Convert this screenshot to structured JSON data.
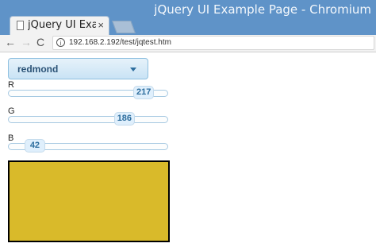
{
  "window": {
    "title": "jQuery UI Example Page - Chromium"
  },
  "tab": {
    "label": "jQuery UI Example Page",
    "close": "×"
  },
  "toolbar": {
    "back": "←",
    "forward": "→",
    "reload": "C",
    "info": "i",
    "url": "192.168.2.192/test/jqtest.htm"
  },
  "theme_select": {
    "value": "redmond"
  },
  "sliders": {
    "r": {
      "label": "R",
      "value": 217,
      "max": 255
    },
    "g": {
      "label": "G",
      "value": 186,
      "max": 255
    },
    "b": {
      "label": "B",
      "value": 42,
      "max": 255
    }
  },
  "swatch": {
    "color": "#d9ba2a"
  }
}
